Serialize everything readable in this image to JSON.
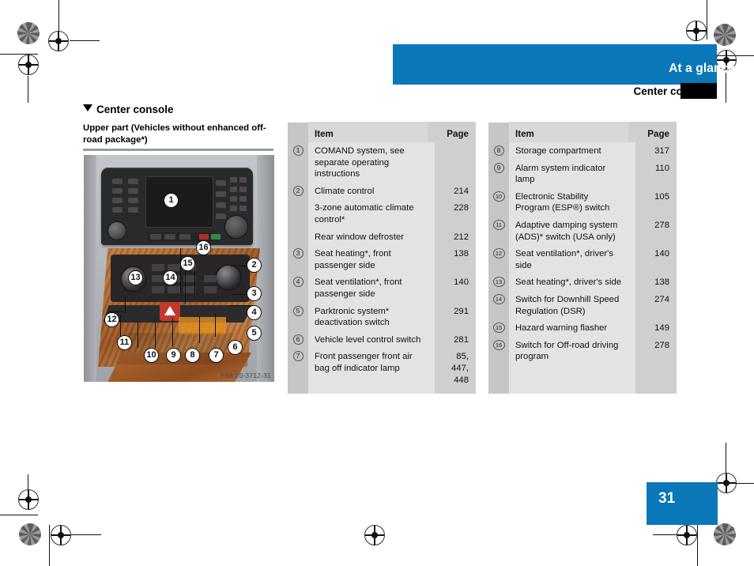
{
  "header": {
    "banner_title": "At a glance",
    "subhead": "Center console"
  },
  "section": {
    "title": "Center console",
    "subtitle": "Upper part (Vehicles without enhanced off-road package*)"
  },
  "figure": {
    "code": "P68.20-3712-31",
    "callouts": [
      "1",
      "2",
      "3",
      "4",
      "5",
      "6",
      "7",
      "8",
      "9",
      "10",
      "11",
      "12",
      "13",
      "14",
      "15",
      "16"
    ]
  },
  "tables": {
    "left": {
      "col_item": "Item",
      "col_page": "Page",
      "rows": [
        {
          "num": "1",
          "item": "COMAND system, see separate operating instructions",
          "page": ""
        },
        {
          "num": "2",
          "item": "Climate control",
          "page": "214"
        },
        {
          "num": "",
          "item": "3-zone automatic climate control*",
          "page": "228"
        },
        {
          "num": "",
          "item": "Rear window defroster",
          "page": "212"
        },
        {
          "num": "3",
          "item": "Seat heating*,\nfront passenger side",
          "page": "138"
        },
        {
          "num": "4",
          "item": "Seat ventilation*,\nfront passenger side",
          "page": "140"
        },
        {
          "num": "5",
          "item": "Parktronic system*\ndeactivation switch",
          "page": "291"
        },
        {
          "num": "6",
          "item": "Vehicle level control switch",
          "page": "281"
        },
        {
          "num": "7",
          "item": "Front passenger front air bag off indicator lamp",
          "page": "85,\n447,\n448"
        }
      ]
    },
    "right": {
      "col_item": "Item",
      "col_page": "Page",
      "rows": [
        {
          "num": "8",
          "item": "Storage compartment",
          "page": "317"
        },
        {
          "num": "9",
          "item": "Alarm system indicator lamp",
          "page": "110"
        },
        {
          "num": "10",
          "item": "Electronic Stability Program (ESP®) switch",
          "page": "105"
        },
        {
          "num": "11",
          "item": "Adaptive damping system (ADS)* switch (USA only)",
          "page": "278"
        },
        {
          "num": "12",
          "item": "Seat ventilation*,\ndriver's side",
          "page": "140"
        },
        {
          "num": "13",
          "item": "Seat heating*, driver's side",
          "page": "138"
        },
        {
          "num": "14",
          "item": "Switch for Downhill Speed Regulation (DSR)",
          "page": "274"
        },
        {
          "num": "15",
          "item": "Hazard warning flasher",
          "page": "149"
        },
        {
          "num": "16",
          "item": "Switch for Off-road driving program",
          "page": "278"
        }
      ]
    }
  },
  "footer": {
    "page_number": "31"
  },
  "colors": {
    "brand_blue": "#0a77b8",
    "table_body": "#e3e3e3",
    "table_num_col": "#c6c6c6",
    "table_page_col": "#cfcfcf",
    "table_header": "#d8d8d8"
  }
}
